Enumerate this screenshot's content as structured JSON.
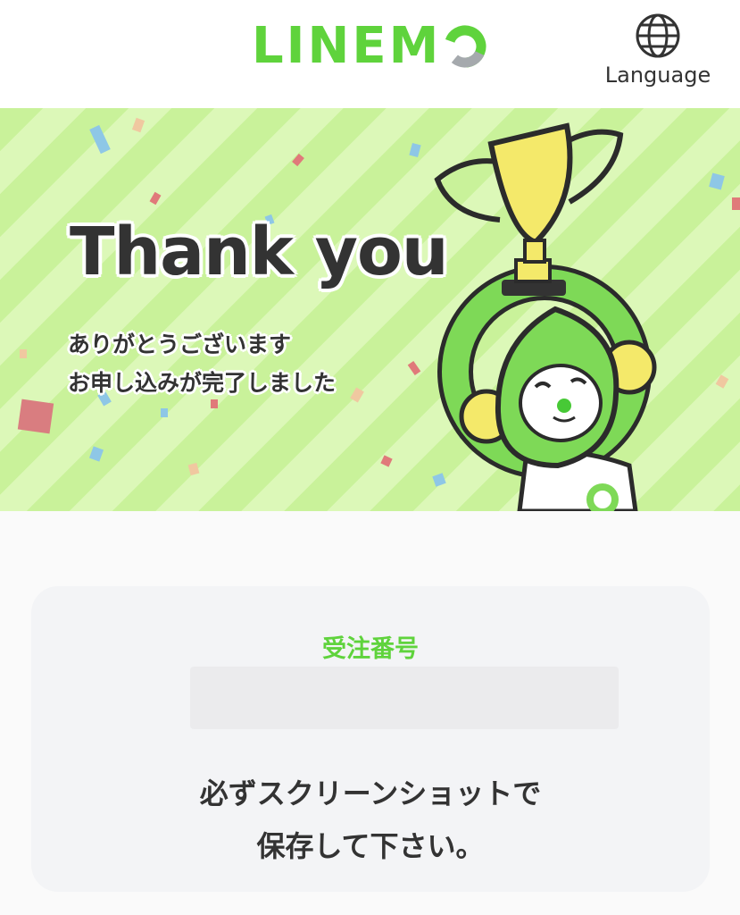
{
  "header": {
    "logo_text": "LINEM",
    "logo_name": "LINEMO",
    "language_label": "Language",
    "language_icon": "globe-icon"
  },
  "hero": {
    "title": "Thank you",
    "message_line1": "ありがとうございます",
    "message_line2": "お申し込みが完了しました",
    "illustration": "mascot-with-trophy"
  },
  "order": {
    "label": "受注番号",
    "number": "",
    "note_line1": "必ずスクリーンショットで",
    "note_line2": "保存して下さい。"
  },
  "colors": {
    "brand_green": "#5fd33c",
    "text_dark": "#333333",
    "hero_stripe_light": "#dcf8b8",
    "hero_stripe_dark": "#c9f29a",
    "card_bg": "#f3f4f6"
  }
}
